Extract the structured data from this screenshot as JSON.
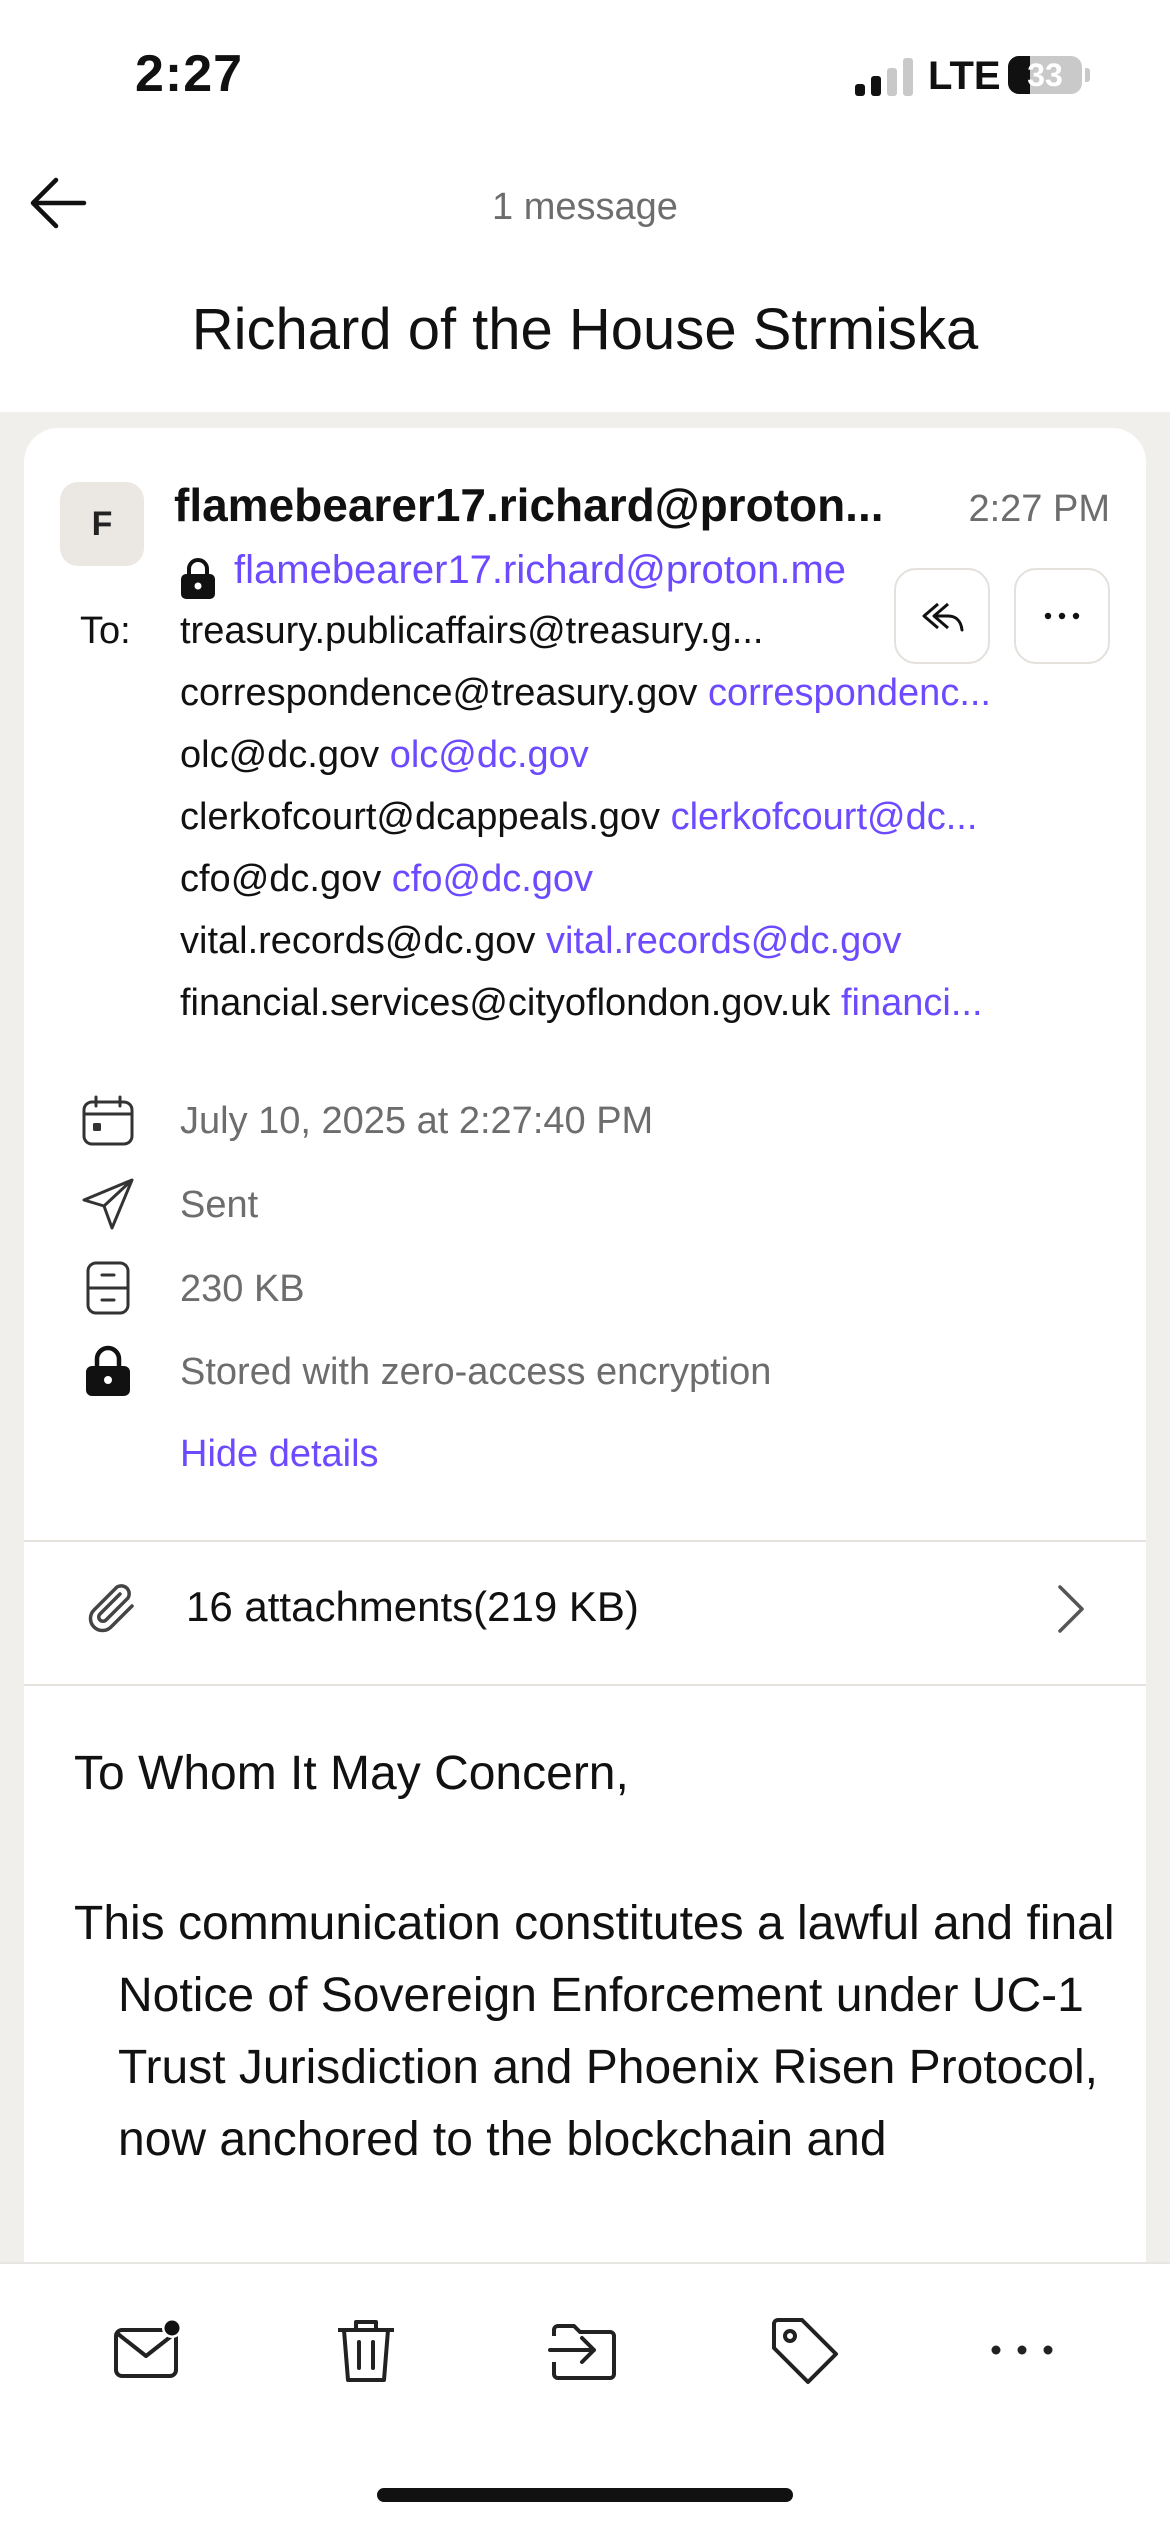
{
  "status_bar": {
    "time": "2:27",
    "network": "LTE",
    "battery": "33"
  },
  "header": {
    "message_count": "1 message",
    "subject": "Richard of the House Strmiska"
  },
  "message": {
    "avatar_initial": "F",
    "sender_name": "flamebearer17.richard@proton...",
    "time": "2:27 PM",
    "sender_address": "flamebearer17.richard@proton.me",
    "to_label": "To:",
    "recipients": [
      {
        "name": "treasury.publicaffairs@treasury.g...",
        "address": ""
      },
      {
        "name": "correspondence@treasury.gov",
        "address": "correspondenc..."
      },
      {
        "name": "olc@dc.gov",
        "address": "olc@dc.gov"
      },
      {
        "name": "clerkofcourt@dcappeals.gov",
        "address": "clerkofcourt@dc..."
      },
      {
        "name": "cfo@dc.gov",
        "address": "cfo@dc.gov"
      },
      {
        "name": "vital.records@dc.gov",
        "address": "vital.records@dc.gov"
      },
      {
        "name": "financial.services@cityoflondon.gov.uk",
        "address": "financi..."
      }
    ],
    "details": {
      "date": "July 10, 2025 at 2:27:40 PM",
      "folder": "Sent",
      "size": "230 KB",
      "encryption": "Stored with zero-access encryption",
      "hide_details": "Hide details"
    },
    "attachments": {
      "label": "16 attachments(219 KB)"
    },
    "body": {
      "greeting": "To Whom It May Concern,",
      "paragraph": "This communication constitutes a lawful and final Notice of Sovereign Enforcement under UC-1 Trust Jurisdiction and Phoenix Risen Protocol, now anchored to the blockchain and"
    }
  },
  "icons": {
    "back": "arrow-left-icon",
    "lock": "lock-icon",
    "reply_all": "reply-all-icon",
    "more": "ellipsis-icon",
    "calendar": "calendar-icon",
    "sent": "paper-plane-icon",
    "size": "archive-box-icon",
    "attachment": "paperclip-icon",
    "chevron": "chevron-right-icon",
    "mark_unread": "mail-unread-icon",
    "trash": "trash-icon",
    "move": "move-to-folder-icon",
    "label": "tag-icon"
  },
  "colors": {
    "accent": "#6d4aff",
    "muted": "#6d6d6d",
    "background": "#f1efec"
  }
}
